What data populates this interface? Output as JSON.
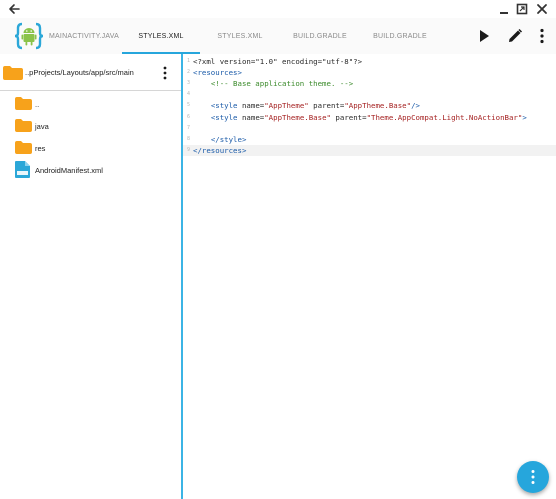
{
  "titlebar": {
    "back_icon": "arrow-back-icon",
    "minimize_icon": "minimize-icon",
    "maximize_icon": "maximize-icon",
    "close_icon": "close-icon"
  },
  "toolbar": {
    "logo_icon": "android-braces-logo-icon",
    "tabs": [
      {
        "label": "MAINACTIVITY.JAVA",
        "active": false
      },
      {
        "label": "STYLES.XML",
        "active": true
      },
      {
        "label": "STYLES.XML",
        "active": false
      },
      {
        "label": "BUILD.GRADLE",
        "active": false
      },
      {
        "label": "BUILD.GRADLE",
        "active": false
      }
    ],
    "run_icon": "play-icon",
    "edit_icon": "pencil-icon",
    "more_icon": "more-vertical-icon"
  },
  "explorer": {
    "path": "..pProjects/Layouts/app/src/main",
    "items": [
      {
        "label": "..",
        "icon": "folder-icon"
      },
      {
        "label": "java",
        "icon": "folder-icon"
      },
      {
        "label": "res",
        "icon": "folder-icon"
      },
      {
        "label": "AndroidManifest.xml",
        "icon": "xml-file-icon"
      }
    ]
  },
  "editor": {
    "lines": [
      {
        "n": "1",
        "tokens": [
          [
            "plain",
            "<?xml version=\"1.0\" encoding=\"utf-8\"?>"
          ]
        ]
      },
      {
        "n": "2",
        "tokens": [
          [
            "tag",
            "<resources>"
          ]
        ]
      },
      {
        "n": "3",
        "tokens": [
          [
            "plain",
            "    "
          ],
          [
            "com",
            "<!-- Base application theme. -->"
          ]
        ]
      },
      {
        "n": "4",
        "tokens": []
      },
      {
        "n": "5",
        "tokens": [
          [
            "plain",
            "    "
          ],
          [
            "tag",
            "<style "
          ],
          [
            "attr",
            "name="
          ],
          [
            "str",
            "\"AppTheme\""
          ],
          [
            "attr",
            " parent="
          ],
          [
            "str",
            "\"AppTheme.Base\""
          ],
          [
            "tag",
            "/>"
          ]
        ]
      },
      {
        "n": "6",
        "tokens": [
          [
            "plain",
            "    "
          ],
          [
            "tag",
            "<style "
          ],
          [
            "attr",
            "name="
          ],
          [
            "str",
            "\"AppTheme.Base\""
          ],
          [
            "attr",
            " parent="
          ],
          [
            "str",
            "\"Theme.AppCompat.Light.NoActionBar\""
          ],
          [
            "tag",
            ">"
          ]
        ]
      },
      {
        "n": "7",
        "tokens": []
      },
      {
        "n": "8",
        "tokens": [
          [
            "plain",
            "    "
          ],
          [
            "tag",
            "</style>"
          ]
        ]
      },
      {
        "n": "9",
        "tokens": [
          [
            "tag",
            "</resources>"
          ]
        ]
      }
    ],
    "current_line": 9
  },
  "fab": {
    "icon": "more-vertical-icon",
    "color": "#26a6dc"
  },
  "colors": {
    "accent": "#26a6dc",
    "folder": "#f7a21b"
  }
}
